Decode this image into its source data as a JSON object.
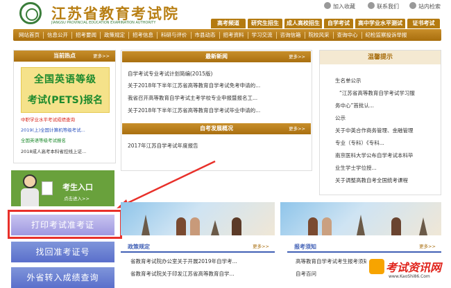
{
  "header": {
    "title": "江苏省教育考试院",
    "subtitle": "JIANGSU PROVINCIAL EDUCATION EXAMINATION AUTHORITY",
    "util_links": [
      "加入收藏",
      "联系我们",
      "站内检索"
    ],
    "categories": [
      "高考频道",
      "研究生招生",
      "成人高校招生",
      "自学考试",
      "高中学业水平测试",
      "证书考试"
    ]
  },
  "nav": [
    "网站首页",
    "信息公开",
    "招考要闻",
    "政策规定",
    "招考信息",
    "科研与评价",
    "市县动态",
    "招考资料",
    "学习交流",
    "咨询信箱",
    "院校风采",
    "查询中心",
    "纪检监察投诉举报"
  ],
  "hot": {
    "title": "当前热点",
    "more": "更多>>",
    "banner_line1": "全国英语等级",
    "banner_line2": "考试(PETS)报名",
    "items": [
      {
        "text": "中职学业水平考试成绩查询",
        "color": "#d9261c"
      },
      {
        "text": "2019(上)全国计算机等级考试...",
        "color": "#2a52be"
      },
      {
        "text": "全国英语等级考试报名",
        "color": "#1d8a2d"
      },
      {
        "text": "2018成人高考本科省控线上证...",
        "color": "#333333"
      }
    ]
  },
  "news": {
    "title": "最新新闻",
    "more": "更多>>",
    "items": [
      "自学考试专业考试计划简编(2015版)",
      "关于2018年下半年江苏省高等教育自学考试免考申请的...",
      "我省召开高等教育自学考试主考学校专业申报暨报名工...",
      "关于2018年下半年江苏省高等教育自学考试毕业申请的..."
    ]
  },
  "research": {
    "title": "自考发展概况",
    "more": "更多>>",
    "items": [
      "2017年江苏自学考试年度报告"
    ]
  },
  "notice": {
    "title": "温馨提示",
    "lines": [
      "生名单公示",
      "“江苏省高等教育自学考试学习服",
      "务中心”首批认...",
      "公示",
      "关于中英合作商务管理、金融管理",
      "专业（专科）《专科...",
      "南京医科大学公布自学考试本科毕",
      "业生学士学位授...",
      "关于调整高教自考全国统考课程"
    ]
  },
  "entry": {
    "title": "考生入口",
    "sub": "点击进入>>"
  },
  "buttons": {
    "print": "打印考试准考证",
    "find": "找回准考证号",
    "transfer": "外省转入成绩查询"
  },
  "policy": {
    "title": "政策规定",
    "more": "更多>>",
    "items": [
      "省教育考试院办公室关于开展2019年自学考...",
      "省教育考试院关于印发江苏省高等教育自学..."
    ]
  },
  "apply": {
    "title": "报考须知",
    "more": "更多>>",
    "items": [
      "高等教育自学考试考生报考须知(2014)",
      "自考百问"
    ]
  },
  "watermark": {
    "text": "考试资讯网",
    "url": "www.KaoShi86.Com"
  },
  "colors": {
    "brand_gold": "#b87f14",
    "brand_green": "#3a7d3a",
    "accent_blue": "#3f5fb5",
    "highlight_red": "#e8302a"
  }
}
